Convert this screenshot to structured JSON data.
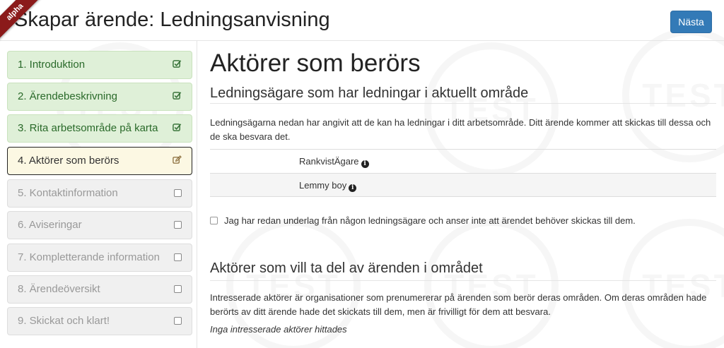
{
  "ribbon": {
    "label": "alpha"
  },
  "header": {
    "title": "Skapar ärende: Ledningsanvisning",
    "next_label": "Nästa"
  },
  "watermark": {
    "text": "TEST"
  },
  "sidebar": {
    "steps": [
      {
        "label": "1. Introduktion",
        "state": "done",
        "icon": "check-square-icon"
      },
      {
        "label": "2. Ärendebeskrivning",
        "state": "done",
        "icon": "check-square-icon"
      },
      {
        "label": "3. Rita arbetsområde på karta",
        "state": "done",
        "icon": "check-square-icon"
      },
      {
        "label": "4. Aktörer som berörs",
        "state": "active",
        "icon": "edit-icon"
      },
      {
        "label": "5. Kontaktinformation",
        "state": "todo",
        "icon": "empty-square-icon"
      },
      {
        "label": "6. Aviseringar",
        "state": "todo",
        "icon": "empty-square-icon"
      },
      {
        "label": "7. Kompletterande information",
        "state": "todo",
        "icon": "empty-square-icon"
      },
      {
        "label": "8. Ärendeöversikt",
        "state": "todo",
        "icon": "empty-square-icon"
      },
      {
        "label": "9. Skickat och klart!",
        "state": "todo",
        "icon": "empty-square-icon"
      }
    ]
  },
  "main": {
    "heading": "Aktörer som berörs",
    "owners": {
      "heading": "Ledningsägare som har ledningar i aktuellt område",
      "description": "Ledningsägarna nedan har angivit att de kan ha ledningar i ditt arbetsområde. Ditt ärende kommer att skickas till dessa och de ska besvara det.",
      "rows": [
        {
          "name": "RankvistÄgare"
        },
        {
          "name": "Lemmy boy"
        }
      ],
      "checkbox_label": "Jag har redan underlag från någon ledningsägare och anser inte att ärendet behöver skickas till dem."
    },
    "interested": {
      "heading": "Aktörer som vill ta del av ärenden i området",
      "description": "Intresserade aktörer är organisationer som prenumererar på ärenden som berör deras områden. Om deras områden hade berörts av ditt ärende hade det skickats till dem, men är frivilligt för dem att besvara.",
      "empty_text": "Inga intresserade aktörer hittades"
    }
  },
  "colors": {
    "done_bg": "#dff0d8",
    "active_bg": "#fcf8e3",
    "todo_bg": "#f0f0f0",
    "primary": "#337ab7",
    "ribbon": "#8b1a1a"
  }
}
